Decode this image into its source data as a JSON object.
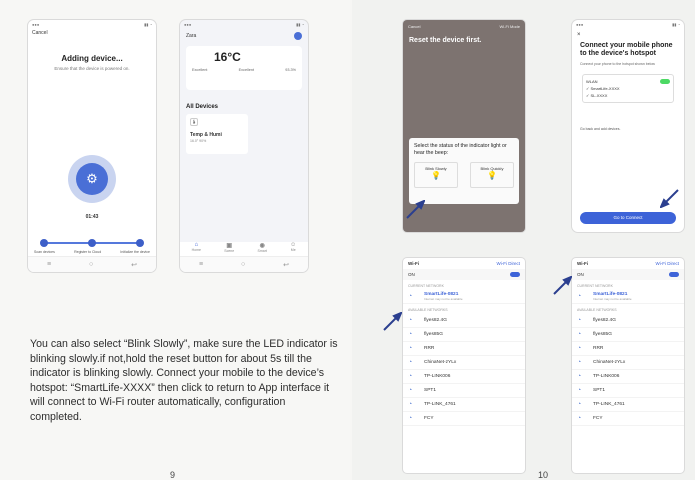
{
  "left_page": {
    "phone_adding": {
      "cancel": "Cancel",
      "title": "Adding device...",
      "subtitle": "Ensure that the device is powered on.",
      "time": "01:43",
      "steps": [
        "Scan devices",
        "Register to Cloud",
        "Initialize the device"
      ]
    },
    "phone_home": {
      "home_name": "Zara",
      "temperature": "16°C",
      "weather_items": [
        "Excellent",
        "Excellent",
        "93.3%"
      ],
      "all_devices": "All Devices",
      "device_name": "Temp & Humi",
      "device_reading": "16.0° 90%",
      "tabs": [
        "Home",
        "Scene",
        "Smart",
        "Me"
      ]
    },
    "instructions": "You can also select “Blink Slowly”, make sure the LED indicator is blinking slowly.if not,hold the reset button for about 5s till the indicator is blinking slowly. Connect your mobile to the device’s hotspot: “SmartLife-XXXX” then click to return to App interface it will connect to Wi-Fi router automatically, configuration completed.",
    "page_number": "9"
  },
  "right_page": {
    "phone_reset": {
      "cancel": "Cancel",
      "mode": "Wi-Fi Mode",
      "title": "Reset the device first.",
      "sheet_title": "Select the status of the indicator light or hear the beep:",
      "option_slow": "Blink Slowly",
      "option_quick": "Blink Quickly"
    },
    "phone_hotspot": {
      "close": "×",
      "title": "Connect your mobile phone to the device's hotspot",
      "subtitle": "Connect your phone to the hotspot shown below",
      "wlan": "WLAN",
      "networks": [
        "SmartLife-XXXX",
        "SL-XXXX"
      ],
      "back_hint": "Go back and add devices.",
      "button": "Go to Connect"
    },
    "wifi_left": {
      "title": "Wi-Fi",
      "direct": "Wi-Fi Direct",
      "on": "ON",
      "current_label": "CURRENT NETWORK",
      "current": "SmartLife-0821",
      "current_sub": "Internet may not be available",
      "available_label": "AVAILABLE NETWORKS",
      "networks": [
        "flyes82.4G",
        "flyes85G",
        "RRR",
        "ChinaNet-zYLx",
        "TP-LINK006",
        "SPT1",
        "TP-LINK_4761",
        "FCY"
      ]
    },
    "wifi_right": {
      "title": "Wi-Fi",
      "direct": "Wi-Fi Direct",
      "on": "ON",
      "current_label": "CURRENT NETWORK",
      "current": "SmartLife-0821",
      "current_sub": "Internet may not be available",
      "available_label": "AVAILABLE NETWORKS",
      "networks": [
        "flyes82.4G",
        "flyes85G",
        "RRR",
        "ChinaNet-zYLx",
        "TP-LINK006",
        "SPT1",
        "TP-LINK_4761",
        "FCY"
      ]
    },
    "page_number": "10"
  },
  "colors": {
    "accent": "#3d63d8",
    "arrow": "#2b3f8f"
  }
}
